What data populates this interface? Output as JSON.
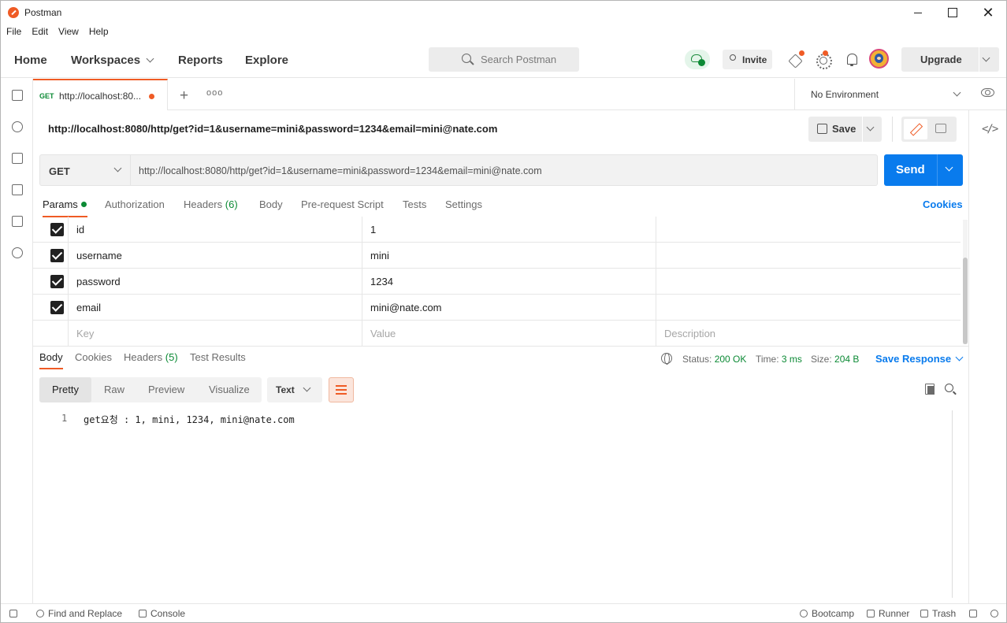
{
  "window": {
    "title": "Postman"
  },
  "menu": [
    "File",
    "Edit",
    "View",
    "Help"
  ],
  "header": {
    "nav": [
      "Home",
      "Workspaces",
      "Reports",
      "Explore"
    ],
    "search_placeholder": "Search Postman",
    "invite_label": "Invite",
    "upgrade_label": "Upgrade"
  },
  "tabstrip": {
    "active_tab": {
      "method": "GET",
      "name": "http://localhost:80..."
    },
    "environment": "No Environment"
  },
  "request": {
    "title": "http://localhost:8080/http/get?id=1&username=mini&password=1234&email=mini@nate.com",
    "save_label": "Save",
    "method": "GET",
    "url": "http://localhost:8080/http/get?id=1&username=mini&password=1234&email=mini@nate.com",
    "send_label": "Send",
    "tabs": [
      {
        "label": "Params"
      },
      {
        "label": "Authorization"
      },
      {
        "label": "Headers",
        "count": "(6)"
      },
      {
        "label": "Body"
      },
      {
        "label": "Pre-request Script"
      },
      {
        "label": "Tests"
      },
      {
        "label": "Settings"
      }
    ],
    "cookies_label": "Cookies",
    "params": [
      {
        "key": "id",
        "value": "1",
        "checked": true
      },
      {
        "key": "username",
        "value": "mini",
        "checked": true
      },
      {
        "key": "password",
        "value": "1234",
        "checked": true
      },
      {
        "key": "email",
        "value": "mini@nate.com",
        "checked": true
      }
    ],
    "placeholders": {
      "key": "Key",
      "value": "Value",
      "description": "Description"
    }
  },
  "response": {
    "tabs": [
      {
        "label": "Body"
      },
      {
        "label": "Cookies"
      },
      {
        "label": "Headers",
        "count": "(5)"
      },
      {
        "label": "Test Results"
      }
    ],
    "status_label": "Status:",
    "status_value": "200 OK",
    "time_label": "Time:",
    "time_value": "3 ms",
    "size_label": "Size:",
    "size_value": "204 B",
    "save_response_label": "Save Response",
    "formats": [
      "Pretty",
      "Raw",
      "Preview",
      "Visualize"
    ],
    "language": "Text",
    "body_lines": [
      {
        "num": "1",
        "text": "get요청 : 1, mini, 1234, mini@nate.com"
      }
    ]
  },
  "footer": {
    "find_replace": "Find and Replace",
    "console": "Console",
    "bootcamp": "Bootcamp",
    "runner": "Runner",
    "trash": "Trash"
  },
  "colors": {
    "accent": "#ef5b25",
    "primary_blue": "#097bed",
    "success_green": "#0c8a35"
  }
}
